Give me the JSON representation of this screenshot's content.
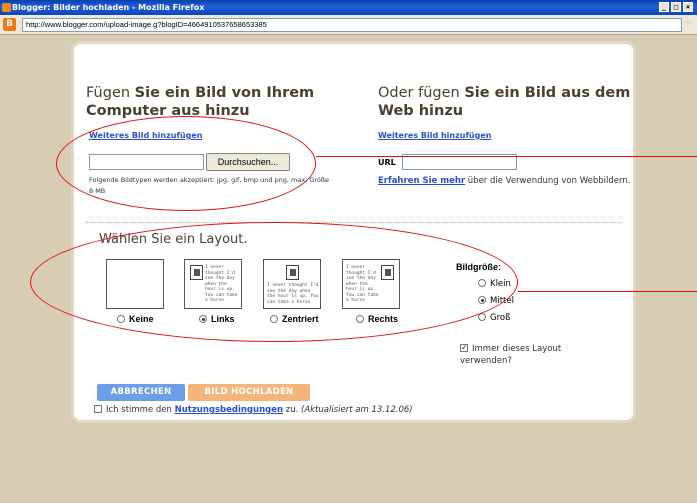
{
  "window": {
    "title": "Blogger: Bilder hochladen - Mozilla Firefox",
    "buttons": [
      "_",
      "□",
      "×"
    ]
  },
  "address": {
    "url": "http://www.blogger.com/upload-image.g?blogID=4664910537658653385"
  },
  "left": {
    "heading_pre": "Fügen",
    "heading_bold": "Sie ein Bild von Ihrem Computer aus hinzu",
    "add_more": "Weiteres Bild hinzufügen",
    "browse_label": "Durchsuchen...",
    "file_types": "Folgende Bildtypen werden akzeptiert: jpg, gif, bmp und png, max. Größe 8 MB"
  },
  "right": {
    "heading_pre": "Oder fügen",
    "heading_bold": "Sie ein Bild aus dem Web hinzu",
    "add_more": "Weiteres Bild hinzufügen",
    "url_label": "URL",
    "learn_link": "Erfahren Sie mehr",
    "learn_rest": " über die Verwendung von Webbildern."
  },
  "layout": {
    "title": "Wählen Sie ein Layout.",
    "thumb_text": "I never thought I'd see the day when the hour is up. You can take a horse",
    "options": [
      {
        "label": "Keine",
        "selected": false
      },
      {
        "label": "Links",
        "selected": true
      },
      {
        "label": "Zentriert",
        "selected": false
      },
      {
        "label": "Rechts",
        "selected": false
      }
    ]
  },
  "size": {
    "title": "Bildgröße:",
    "options": [
      {
        "label": "Klein",
        "selected": false
      },
      {
        "label": "Mittel",
        "selected": true
      },
      {
        "label": "Groß",
        "selected": false
      }
    ],
    "always_label": "Immer dieses Layout verwenden?",
    "always_checked": true
  },
  "actions": {
    "cancel": "ABBRECHEN",
    "upload": "BILD HOCHLADEN",
    "terms_pre": "Ich stimme den ",
    "terms_link": "Nutzungsbedingungen",
    "terms_post": " zu. ",
    "terms_updated": "(Aktualisiert am 13.12.06)"
  },
  "colors": {
    "annotation": "#e01010",
    "cancel": "#6a9ee8",
    "upload": "#f5b47a",
    "link": "#2a4ed0"
  }
}
